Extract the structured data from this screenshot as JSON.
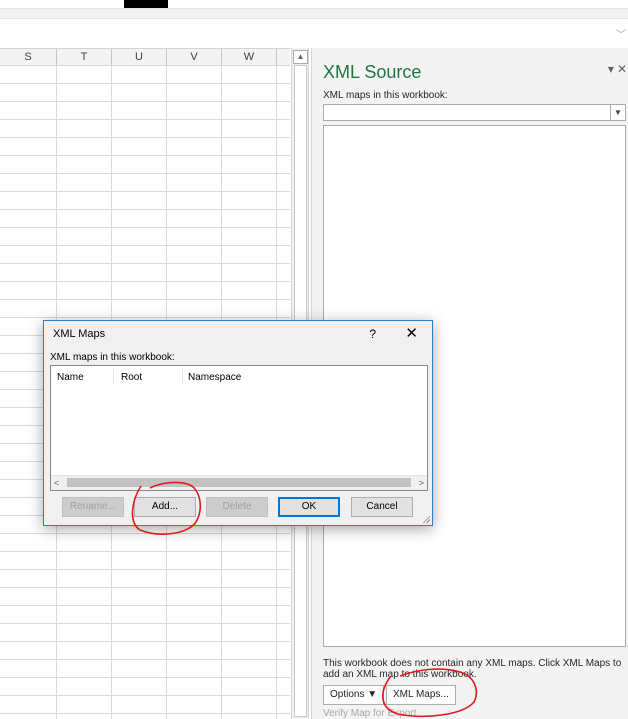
{
  "sheet": {
    "columns": [
      "S",
      "T",
      "U",
      "V",
      "W"
    ]
  },
  "pane": {
    "title": "XML Source",
    "close_controls": [
      "▾",
      "✕"
    ],
    "maps_label": "XML maps in this workbook:",
    "message": "This workbook does not contain any XML maps. Click XML Maps to add an XML map to this workbook.",
    "options_label": "Options ▼",
    "xml_maps_button": "XML Maps...",
    "verify_link": "Verify Map for Export"
  },
  "dialog": {
    "title": "XML Maps",
    "help": "?",
    "close": "✕",
    "list_label": "XML maps in this workbook:",
    "columns": [
      "Name",
      "Root",
      "Namespace"
    ],
    "buttons": {
      "rename": "Rename...",
      "add": "Add...",
      "delete": "Delete",
      "ok": "OK",
      "cancel": "Cancel"
    }
  },
  "colors": {
    "pane_title": "#217346",
    "dialog_border": "#2b7cd3",
    "annotation": "#e0191b"
  }
}
